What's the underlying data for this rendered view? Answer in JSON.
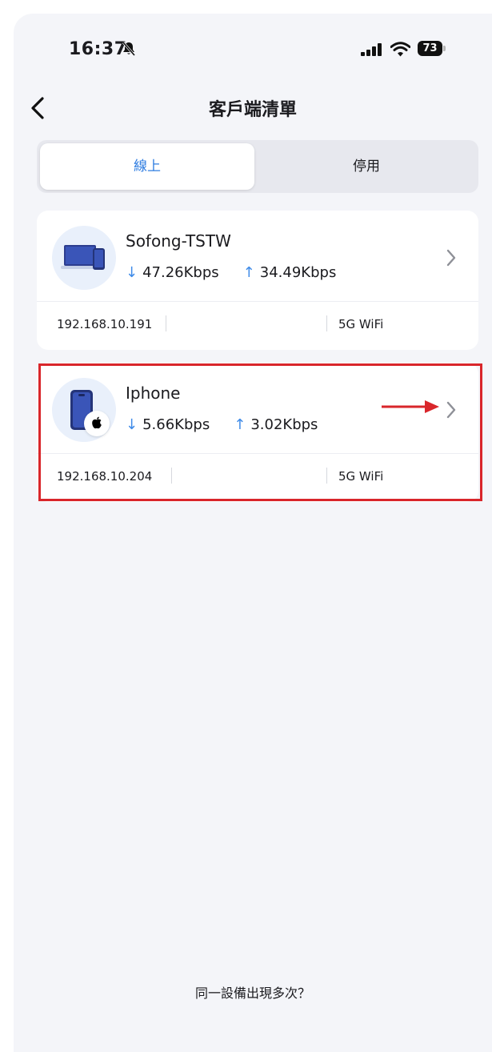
{
  "status_bar": {
    "time": "16:37",
    "battery": "73",
    "icons": [
      "bell-slash-icon",
      "cellular-signal-icon",
      "wifi-icon",
      "battery-icon"
    ]
  },
  "header": {
    "title": "客戶端清單",
    "back_icon": "chevron-left-icon"
  },
  "tabs": [
    {
      "label": "線上",
      "active": true
    },
    {
      "label": "停用",
      "active": false
    }
  ],
  "clients": [
    {
      "name": "Sofong-TSTW",
      "download": "47.26Kbps",
      "upload": "34.49Kbps",
      "ip": "192.168.10.191",
      "network": "5G WiFi",
      "icon": "laptop-phone-icon"
    },
    {
      "name": "Iphone",
      "download": "5.66Kbps",
      "upload": "3.02Kbps",
      "ip": "192.168.10.204",
      "network": "5G WiFi",
      "icon": "iphone-icon",
      "badge_icon": "apple-logo-icon"
    }
  ],
  "arrows": {
    "download": "↓",
    "upload": "↑"
  },
  "footer": {
    "link_text": "同一設備出現多次？"
  },
  "colors": {
    "accent": "#2f7de1",
    "speed_arrow": "#3f8be8",
    "highlight": "#d9262b",
    "background": "#f4f5f9"
  }
}
